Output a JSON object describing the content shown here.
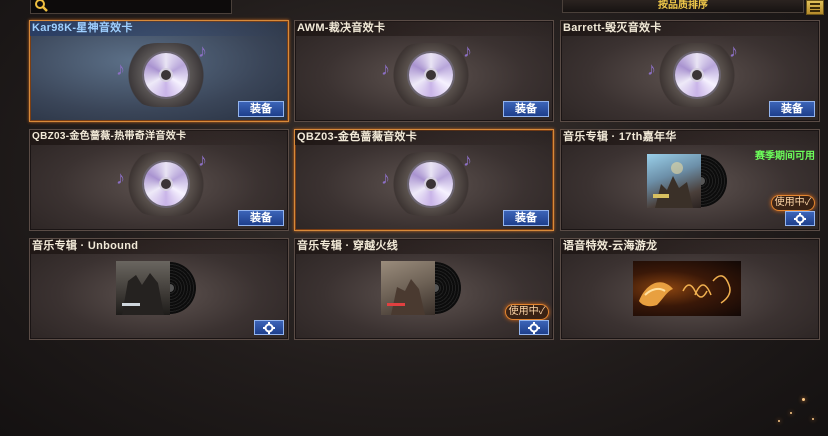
{
  "sort_button": "按品质排序",
  "equip_label": "装备",
  "in_use_label": "使用中✓",
  "season_notice": "赛季期间可用",
  "cards": [
    {
      "title": "Kar98K-星神音效卡"
    },
    {
      "title": "AWM-裁决音效卡"
    },
    {
      "title": "Barrett-毁灭音效卡"
    },
    {
      "title": "QBZ03-金色蔷薇-热带奇洋音效卡"
    },
    {
      "title": "QBZ03-金色蔷薇音效卡"
    },
    {
      "title": "音乐专辑 · 17th嘉年华"
    },
    {
      "title": "音乐专辑 · Unbound"
    },
    {
      "title": "音乐专辑 · 穿越火线"
    },
    {
      "title": "语音特效-云海游龙"
    }
  ],
  "colors": {
    "accent_orange": "#d88a3a",
    "equip_blue": "#2a4fa0",
    "season_green": "#6cff5a",
    "title_blue": "#9fd0ff"
  }
}
